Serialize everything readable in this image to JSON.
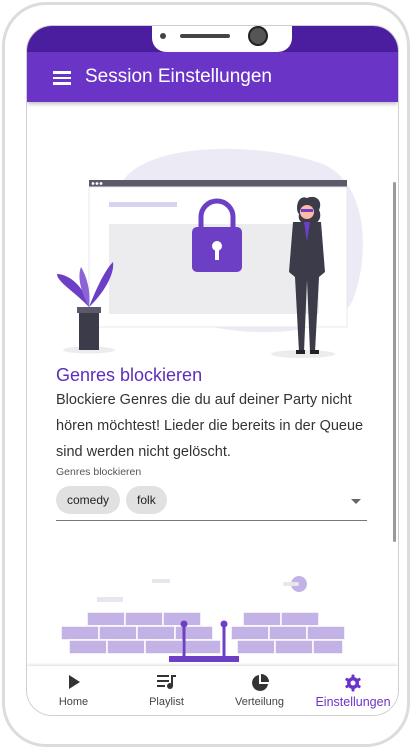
{
  "app": {
    "title": "Session Einstellungen"
  },
  "section": {
    "title": "Genres blockieren",
    "description": "Blockiere Genres die du auf deiner Party nicht hören möchtest! Lieder die bereits in der Queue sind werden nicht gelöscht.",
    "field_label": "Genres blockieren",
    "chips": [
      "comedy",
      "folk"
    ]
  },
  "nav": {
    "items": [
      {
        "label": "Home",
        "icon": "play-icon"
      },
      {
        "label": "Playlist",
        "icon": "playlist-icon"
      },
      {
        "label": "Verteilung",
        "icon": "pie-chart-icon"
      },
      {
        "label": "Einstellungen",
        "icon": "gear-icon",
        "active": true
      }
    ]
  },
  "colors": {
    "primary": "#6a35c7",
    "status_bar": "#4a1e9e",
    "illustration_accent": "#6c3fc4"
  }
}
